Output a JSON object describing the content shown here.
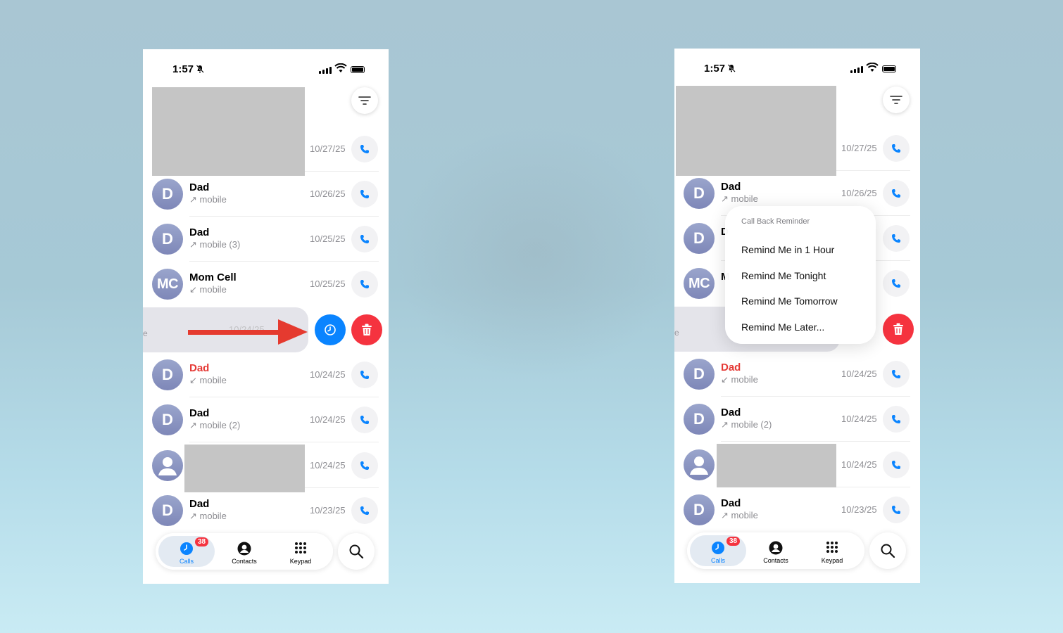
{
  "status": {
    "time": "1:57"
  },
  "colors": {
    "accent": "#0a84ff",
    "destructive": "#f5333f",
    "missed": "#e53935"
  },
  "calls": [
    {
      "name": "",
      "sub": "",
      "date": "10/27/25",
      "redacted": true
    },
    {
      "name": "Dad",
      "sub": "↗ mobile",
      "date": "10/26/25",
      "avatar": "D"
    },
    {
      "name": "Dad",
      "sub": "↗ mobile (3)",
      "date": "10/25/25",
      "avatar": "D"
    },
    {
      "name": "Mom Cell",
      "sub": "↙ mobile",
      "date": "10/25/25",
      "avatar": "MC"
    },
    {
      "name": "Dad",
      "sub": "↙ mobile",
      "date": "10/24/25",
      "avatar": "D",
      "missed": true
    },
    {
      "name": "Dad",
      "sub": "↗ mobile (2)",
      "date": "10/24/25",
      "avatar": "D"
    },
    {
      "name": "",
      "sub": "",
      "date": "10/24/25",
      "avatar": "person-icon",
      "redacted": true
    },
    {
      "name": "Dad",
      "sub": "↗ mobile",
      "date": "10/23/25",
      "avatar": "D"
    }
  ],
  "swipe_row": {
    "ghost_label": "e",
    "ghost_date": "10/24/25"
  },
  "avatars": {
    "D": "D",
    "MC": "MC",
    "M": "M"
  },
  "tabbar": {
    "calls_label": "Calls",
    "calls_badge": "38",
    "contacts_label": "Contacts",
    "keypad_label": "Keypad"
  },
  "menu": {
    "title": "Call Back Reminder",
    "items": [
      "Remind Me in 1 Hour",
      "Remind Me Tonight",
      "Remind Me Tomorrow",
      "Remind Me Later..."
    ]
  },
  "right_partial": {
    "row2_initial": "D",
    "row3_initial": "M"
  }
}
